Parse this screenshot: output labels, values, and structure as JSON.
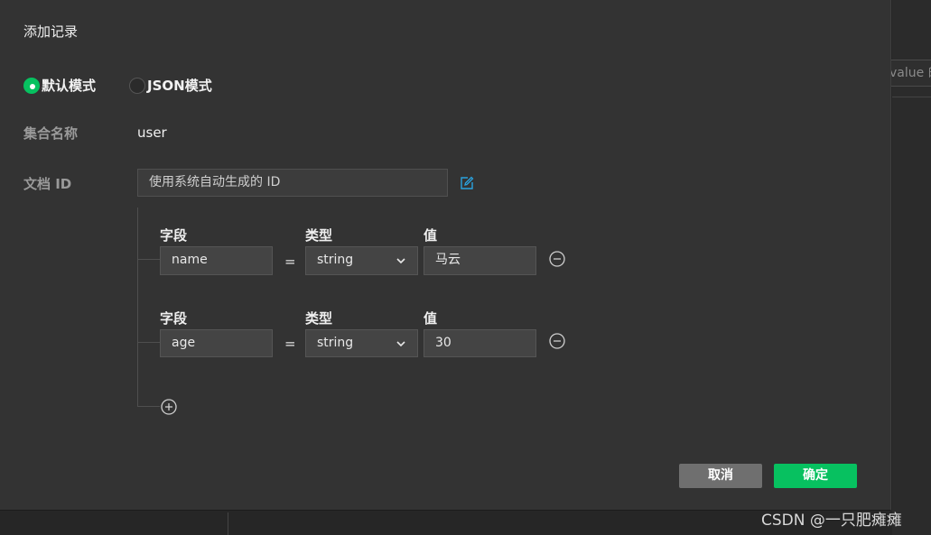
{
  "background": {
    "right_input_text": "value 的"
  },
  "dialog": {
    "title": "添加记录",
    "modes": [
      {
        "label": "默认模式",
        "selected": true
      },
      {
        "label": "JSON模式",
        "selected": false
      }
    ],
    "collection_label": "集合名称",
    "collection_value": "user",
    "docid_label": "文档 ID",
    "docid_placeholder": "使用系统自动生成的 ID",
    "headers": {
      "field": "字段",
      "type": "类型",
      "value": "值"
    },
    "equals": "=",
    "rows": [
      {
        "field": "name",
        "type": "string",
        "value": "马云"
      },
      {
        "field": "age",
        "type": "string",
        "value": "30"
      }
    ],
    "cancel_label": "取消",
    "ok_label": "确定"
  },
  "watermark": "CSDN @一只肥瘫瘫",
  "colors": {
    "accent": "#07c160",
    "dialog_bg": "#333333",
    "input_bg": "#444444",
    "link_blue": "#2aa3e0"
  },
  "icons": [
    "edit-icon",
    "minus-circle-icon",
    "plus-circle-icon",
    "chevron-down-icon"
  ]
}
